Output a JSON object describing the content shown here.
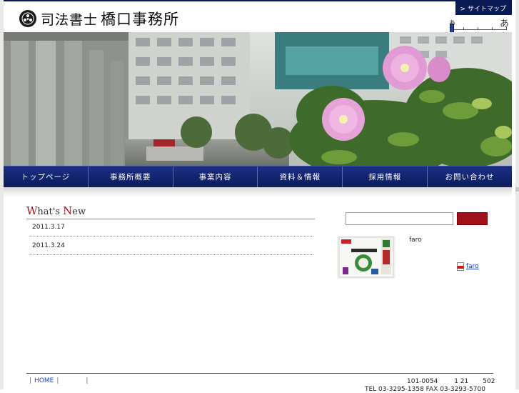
{
  "header": {
    "logo_prefix": "司法書士",
    "logo_name": "橋口事務所",
    "sitemap_label": "サイトマップ",
    "font_size_small_label": "あ",
    "font_size_large_label": "あ"
  },
  "nav": {
    "items": [
      {
        "label": "トップページ"
      },
      {
        "label": "事務所概要"
      },
      {
        "label": "事業内容"
      },
      {
        "label": "資料＆情報"
      },
      {
        "label": "採用情報"
      },
      {
        "label": "お問い合わせ"
      }
    ]
  },
  "news": {
    "title_w": "W",
    "title_rest1": "hat's ",
    "title_n": "N",
    "title_rest2": "ew",
    "items": [
      {
        "date": "2011.3.17"
      },
      {
        "date": "2011.3.24"
      }
    ]
  },
  "sidebar": {
    "search_value": "",
    "faro_title": "faro",
    "pdf_link": "faro"
  },
  "footer": {
    "home_link": "HOME",
    "address_line1": "101-0054        1 21       502",
    "tel_line": "TEL 03-3295-1358 FAX 03-3293-5700"
  },
  "colors": {
    "navy": "#0b1b5a",
    "accent_red": "#a0111a",
    "link_blue": "#1a3dbb"
  }
}
